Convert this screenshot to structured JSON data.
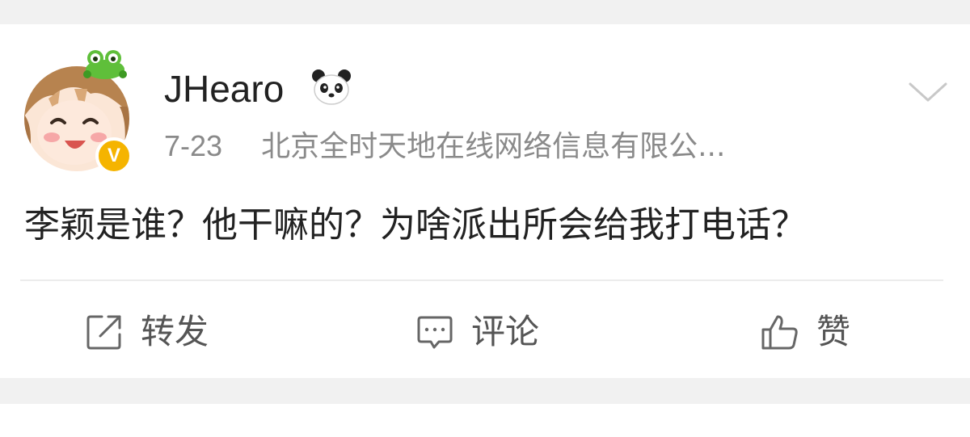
{
  "post": {
    "username": "JHearo",
    "username_badge_icon": "panda-icon",
    "avatar_badge": "V",
    "avatar_badge_color": "#f5b400",
    "time": "7-23",
    "source": "北京全时天地在线网络信息有限公...",
    "text": "李颖是谁？他干嘛的？为啥派出所会给我打电话？",
    "more_icon": "chevron-down-icon"
  },
  "actions": [
    {
      "icon": "repost-icon",
      "label": "转发"
    },
    {
      "icon": "comment-icon",
      "label": "评论"
    },
    {
      "icon": "like-icon",
      "label": "赞"
    }
  ]
}
